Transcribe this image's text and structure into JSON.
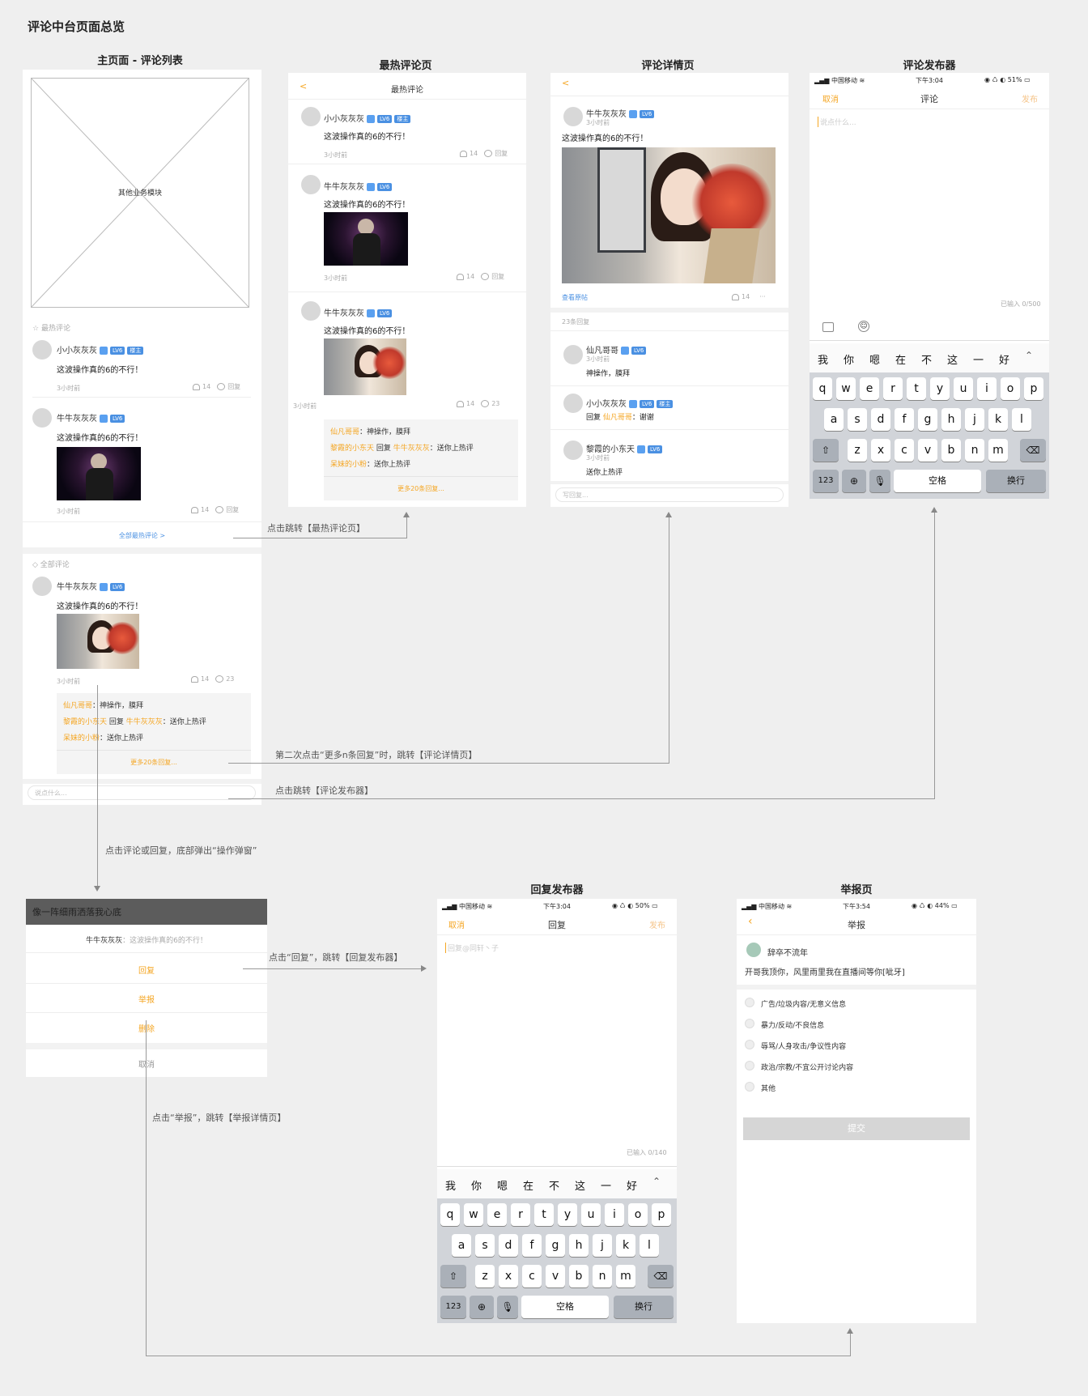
{
  "page_title": "评论中台页面总览",
  "screens": {
    "main": "主页面 - 评论列表",
    "hot": "最热评论页",
    "detail": "评论详情页",
    "composer": "评论发布器",
    "reply_composer": "回复发布器",
    "report": "举报页"
  },
  "main": {
    "placeholder": "其他业务模块",
    "hot_section": "最热评论",
    "all_section": "全部评论",
    "all_hot_link": "全部最热评论 >",
    "input_placeholder": "说点什么...",
    "more_replies": "更多20条回复..."
  },
  "comments": {
    "name_a": "小小灰灰灰",
    "name_b": "牛牛灰灰灰",
    "text": "这波操作真的6的不行！",
    "time": "3小时前",
    "likes": "14",
    "reply": "回复",
    "reply_count": "23",
    "badge": "LV6",
    "badge2": "楼主"
  },
  "replies": [
    {
      "user": "仙凡哥哥",
      "text": "：神操作，膜拜"
    },
    {
      "user": "黎霞的小东天",
      "mid": " 回复 ",
      "target": "牛牛灰灰灰",
      "text": "：送你上热评"
    },
    {
      "user": "呆妹的小粉",
      "text": "：送你上热评"
    }
  ],
  "hot_page": {
    "header": "最热评论",
    "back": "<"
  },
  "detail_page": {
    "back": "<",
    "view_post": "查看原帖",
    "replies_count": "23条回复",
    "input_placeholder": "写回复...",
    "r1_name": "仙凡哥哥",
    "r1_text": "神操作，膜拜",
    "r2_name": "小小灰灰灰",
    "r2_prefix": "回复 ",
    "r2_target": "仙凡哥哥",
    "r2_text": "：谢谢",
    "r3_name": "黎霞的小东天",
    "r3_text": "送你上热评",
    "time": "3小时前",
    "more": "···"
  },
  "composer_page": {
    "carrier": "中国移动",
    "time": "下午3:04",
    "battery": "51%",
    "cancel": "取消",
    "title": "评论",
    "publish": "发布",
    "placeholder": "说点什么...",
    "counter": "已输入 0/500"
  },
  "keyboard": {
    "candidates": [
      "我",
      "你",
      "嗯",
      "在",
      "不",
      "这",
      "一",
      "好"
    ],
    "row1": [
      "q",
      "w",
      "e",
      "r",
      "t",
      "y",
      "u",
      "i",
      "o",
      "p"
    ],
    "row2": [
      "a",
      "s",
      "d",
      "f",
      "g",
      "h",
      "j",
      "k",
      "l"
    ],
    "row3": [
      "z",
      "x",
      "c",
      "v",
      "b",
      "n",
      "m"
    ],
    "num": "123",
    "space": "空格",
    "enter": "换行"
  },
  "popup": {
    "banner": "像一阵细雨洒落我心底",
    "target_user": "牛牛灰灰灰",
    "target_text": "：这波操作真的6的不行！",
    "reply": "回复",
    "report": "举报",
    "delete": "删除",
    "cancel": "取消"
  },
  "reply_page": {
    "carrier": "中国移动",
    "time": "下午3:04",
    "battery": "50%",
    "cancel": "取消",
    "title": "回复",
    "publish": "发布",
    "placeholder": "回复@同轩丶子",
    "counter": "已输入 0/140"
  },
  "report_page": {
    "carrier": "中国移动",
    "time": "下午3:54",
    "battery": "44%",
    "title": "举报",
    "user": "辞卒不流年",
    "content": "开哥我顶你，风里雨里我在直播间等你[呲牙]",
    "options": [
      "广告/垃圾内容/无意义信息",
      "暴力/反动/不良信息",
      "辱骂/人身攻击/争议性内容",
      "政治/宗教/不宜公开讨论内容",
      "其他"
    ],
    "submit": "提交"
  },
  "annotations": {
    "a1": "点击跳转【最热评论页】",
    "a2": "第二次点击“更多n条回复”时，跳转【评论详情页】",
    "a3": "点击跳转【评论发布器】",
    "a4": "点击评论或回复，底部弹出“操作弹窗”",
    "a5": "点击“回复”，跳转【回复发布器】",
    "a6": "点击“举报”，跳转【举报详情页】"
  }
}
